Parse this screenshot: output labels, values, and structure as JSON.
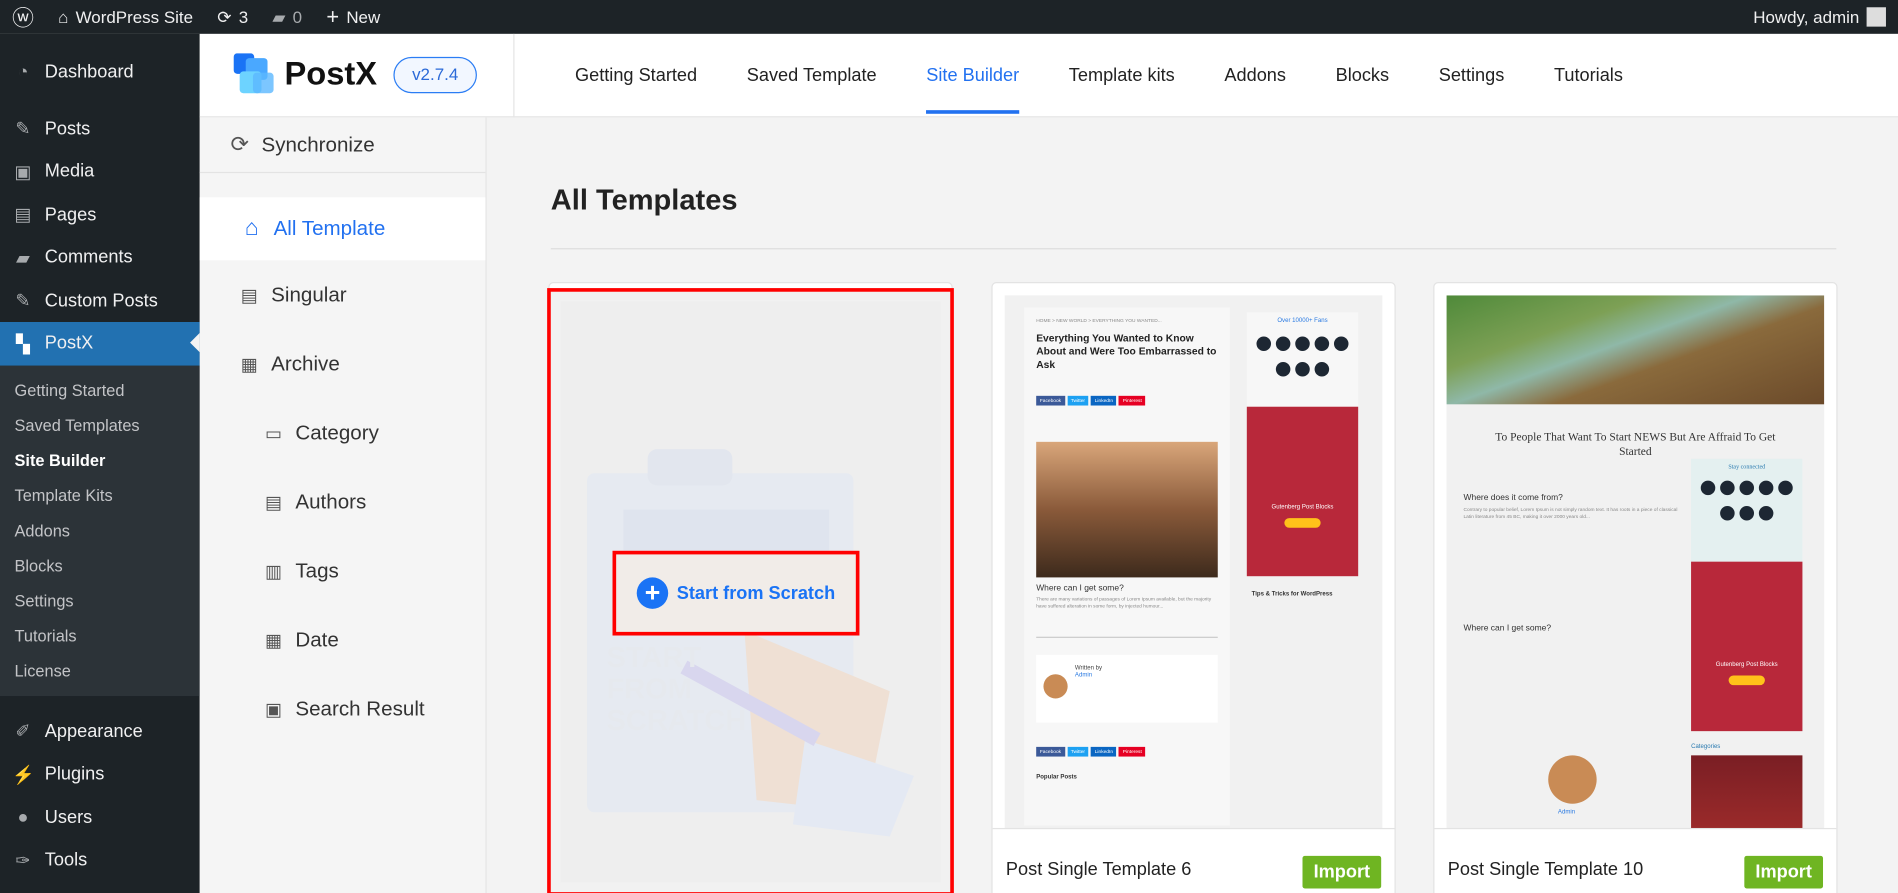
{
  "adminbar": {
    "site": "WordPress Site",
    "updates": "3",
    "comments": "0",
    "new": "New",
    "howdy": "Howdy, admin"
  },
  "menu": {
    "items": [
      "Dashboard",
      "Posts",
      "Media",
      "Pages",
      "Comments",
      "Custom Posts",
      "PostX"
    ],
    "sub": [
      "Getting Started",
      "Saved Templates",
      "Site Builder",
      "Template Kits",
      "Addons",
      "Blocks",
      "Settings",
      "Tutorials",
      "License"
    ],
    "bottom": [
      "Appearance",
      "Plugins",
      "Users",
      "Tools"
    ]
  },
  "postx": {
    "brand": "PostX",
    "version": "v2.7.4",
    "tabs": [
      "Getting Started",
      "Saved Template",
      "Site Builder",
      "Template kits",
      "Addons",
      "Blocks",
      "Settings",
      "Tutorials"
    ],
    "active_tab": "Site Builder",
    "accent": "#2271f0"
  },
  "left": {
    "sync": "Synchronize",
    "items": [
      "All Template",
      "Singular",
      "Archive",
      "Category",
      "Authors",
      "Tags",
      "Date",
      "Search Result"
    ]
  },
  "main": {
    "title": "All Templates",
    "scratch_label": "Start from Scratch",
    "scratch_watermark": "START FROM SCRATCH",
    "cards": [
      {
        "name": "Post Single Template 6",
        "import": "Import",
        "headline": "Everything You Wanted to Know About and Were Too Embarrassed to Ask",
        "fans": "Over 10000+ Fans",
        "sub1": "Where can I get some?",
        "tips": "Tips & Tricks for WordPress",
        "written": "Written by",
        "author": "Admin",
        "popular": "Popular Posts",
        "promo": "Gutenberg Post Blocks"
      },
      {
        "name": "Post Single Template 10",
        "import": "Import",
        "headline": "To People That Want To Start NEWS But Are Affraid To Get Started",
        "sub1": "Where does it come from?",
        "sub2": "Where can I get some?",
        "stay": "Stay connected",
        "author": "Admin",
        "categories": "Categories",
        "promo": "Gutenberg Post Blocks"
      }
    ]
  }
}
